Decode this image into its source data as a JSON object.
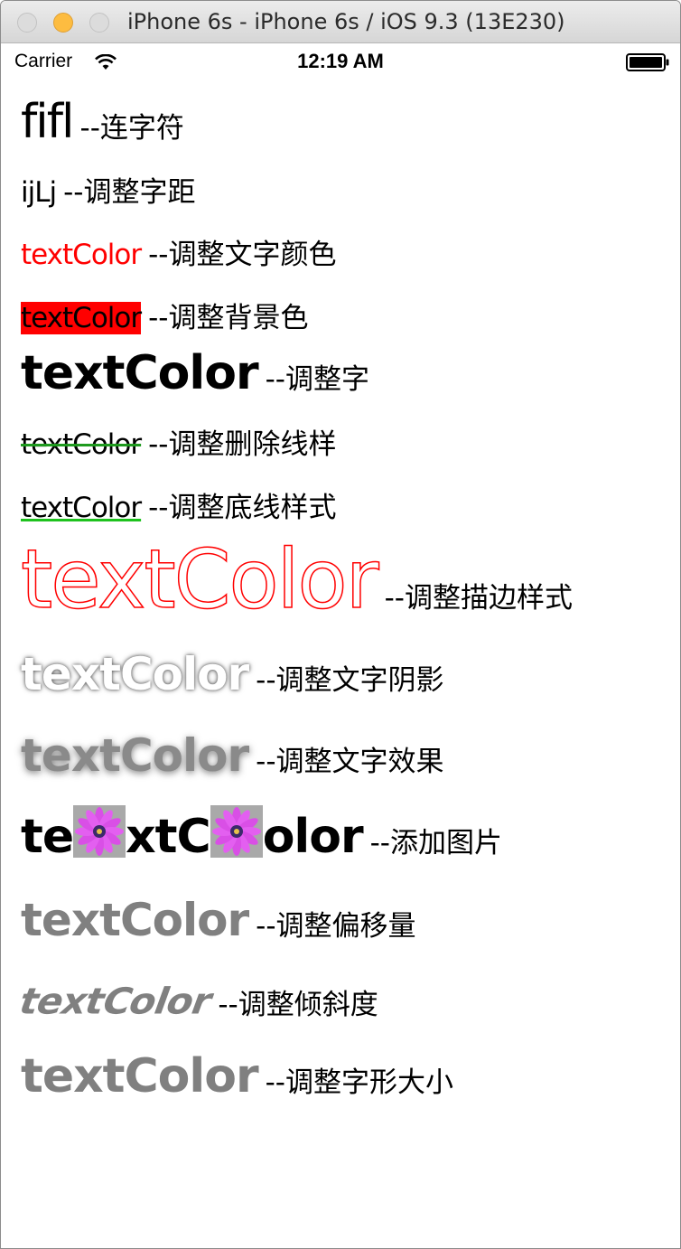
{
  "window": {
    "title": "iPhone 6s - iPhone 6s / iOS 9.3 (13E230)"
  },
  "status_bar": {
    "carrier": "Carrier",
    "time": "12:19 AM",
    "icons": [
      "wifi-icon",
      "battery-icon"
    ]
  },
  "rows": [
    {
      "sample": "fifl",
      "label": "--连字符"
    },
    {
      "sample": "ijLj",
      "label": "--调整字距"
    },
    {
      "sample": "textColor",
      "label": "--调整文字颜色",
      "color": "#ff0000"
    },
    {
      "sample": "textColor",
      "label": "--调整背景色",
      "background": "#ff0000"
    },
    {
      "sample": "textColor",
      "label": "--调整字"
    },
    {
      "sample": "textColor",
      "label": "--调整删除线样",
      "strike_color": "#1e9a1e"
    },
    {
      "sample": "textColor",
      "label": "--调整底线样式",
      "underline_color": "#1ec21e"
    },
    {
      "sample": "textColor",
      "label": "--调整描边样式",
      "stroke_color": "#ff0000"
    },
    {
      "sample": "textColor",
      "label": "--调整文字阴影"
    },
    {
      "sample": "textColor",
      "label": "--调整文字效果"
    },
    {
      "sample_parts": [
        "te",
        "xtC",
        "olor"
      ],
      "label": "--添加图片",
      "image_icon": "flower-icon"
    },
    {
      "sample": "textColor",
      "label": "--调整偏移量",
      "color": "#808080"
    },
    {
      "sample": "textColor",
      "label": "--调整倾斜度",
      "color": "#808080"
    },
    {
      "sample": "textColor",
      "label": "--调整字形大小",
      "color": "#808080"
    }
  ]
}
